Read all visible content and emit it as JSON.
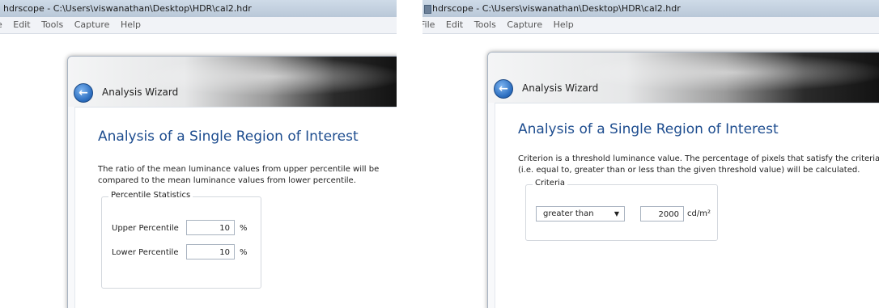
{
  "left": {
    "window_title": "hdrscope - C:\\Users\\viswanathan\\Desktop\\HDR\\cal2.hdr",
    "menu": [
      "e",
      "Edit",
      "Tools",
      "Capture",
      "Help"
    ],
    "wizard_title": "Analysis Wizard",
    "heading": "Analysis of a Single Region of Interest",
    "description": "The ratio of the mean luminance values from upper percentile will be compared to the mean luminance values from lower percentile.",
    "group_title": "Percentile Statistics",
    "upper_label": "Upper Percentile",
    "upper_value": "10",
    "upper_unit": "%",
    "lower_label": "Lower Percentile",
    "lower_value": "10",
    "lower_unit": "%"
  },
  "right": {
    "window_title": "hdrscope - C:\\Users\\viswanathan\\Desktop\\HDR\\cal2.hdr",
    "menu": [
      "File",
      "Edit",
      "Tools",
      "Capture",
      "Help"
    ],
    "wizard_title": "Analysis Wizard",
    "heading": "Analysis of a Single Region of Interest",
    "description": "Criterion is a threshold luminance value. The percentage of pixels that satisfy the criteria (i.e. equal to, greater than or less than the given threshold value) will be calculated.",
    "group_title": "Criteria",
    "criteria_selected": "greater than",
    "threshold_value": "2000",
    "threshold_unit": "cd/m²"
  },
  "icons": {
    "back": "back-arrow-icon",
    "dropdown": "chevron-down-icon",
    "window": "app-window-icon"
  },
  "colors": {
    "heading": "#1e4d8f",
    "back_button": "#2d6fc0"
  }
}
